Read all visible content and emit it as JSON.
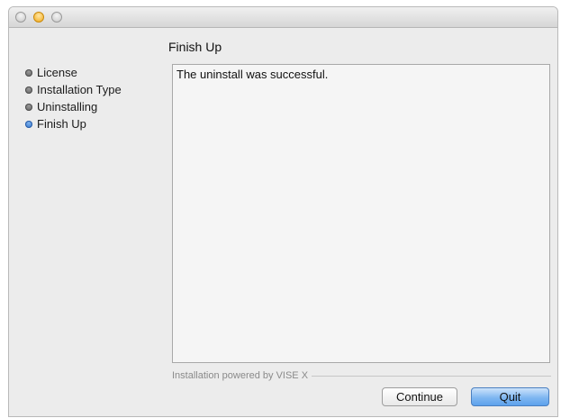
{
  "window": {
    "title": ""
  },
  "page": {
    "title": "Finish Up"
  },
  "sidebar": {
    "steps": [
      {
        "label": "License",
        "active": false
      },
      {
        "label": "Installation Type",
        "active": false
      },
      {
        "label": "Uninstalling",
        "active": false
      },
      {
        "label": "Finish Up",
        "active": true
      }
    ]
  },
  "content": {
    "message": "The uninstall was successful."
  },
  "footer": {
    "powered_by": "Installation powered by VISE X"
  },
  "buttons": {
    "continue_label": "Continue",
    "quit_label": "Quit"
  },
  "colors": {
    "active_bullet": "#2d6fc8",
    "default_button": "#7fb7f1",
    "window_bg": "#ececec"
  }
}
